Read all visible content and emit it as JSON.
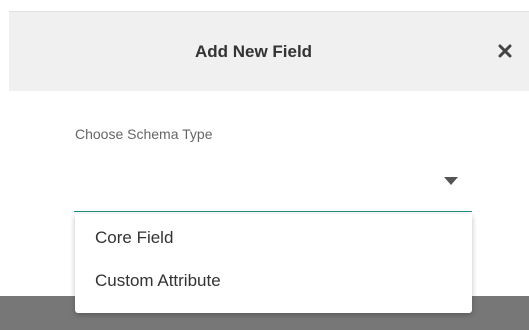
{
  "modal": {
    "title": "Add New Field",
    "close_icon": "close-icon"
  },
  "form": {
    "schema_type": {
      "label": "Choose Schema Type",
      "value": "",
      "caret_icon": "caret-down-icon",
      "accent_color": "#1f8d7c"
    }
  },
  "dropdown": {
    "options": [
      {
        "label": "Core Field"
      },
      {
        "label": "Custom Attribute"
      }
    ]
  }
}
